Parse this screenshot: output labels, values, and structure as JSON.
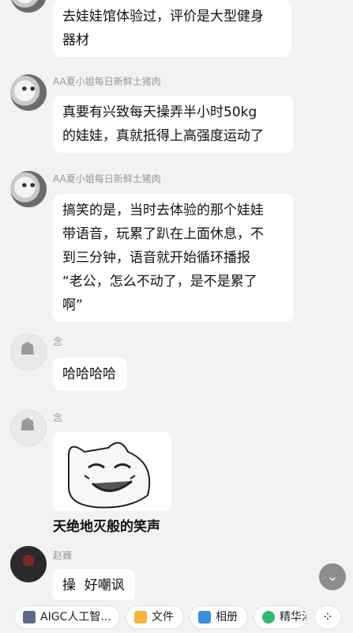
{
  "messages": [
    {
      "lines": [
        "去娃娃馆体验过，评价是大型健身",
        "器材"
      ]
    },
    {
      "sender": "AA夏小姐每日新鲜土猪肉",
      "lines": [
        "真要有兴致每天操弄半小时50kg",
        "的娃娃，真就抵得上高强度运动了"
      ]
    },
    {
      "sender": "AA夏小姐每日新鲜土猪肉",
      "lines": [
        "搞笑的是，当时去体验的那个娃娃",
        "带语音，玩累了趴在上面休息，不",
        "到三分钟，语音就开始循环播报",
        "“老公，怎么不动了，是不是累了",
        "啊”"
      ]
    },
    {
      "sender": "念",
      "lines": [
        "哈哈哈哈"
      ]
    },
    {
      "sender": "念",
      "sticker_caption": "天绝地灭般的笑声"
    },
    {
      "sender": "赵巍",
      "lines": [
        "操  好嘲讽"
      ]
    }
  ],
  "toolbar": {
    "items": [
      {
        "label": "AIGC人工智...",
        "icon": "app-icon"
      },
      {
        "label": "文件",
        "icon": "folder-icon"
      },
      {
        "label": "相册",
        "icon": "photo-icon"
      },
      {
        "label": "精华消",
        "icon": "star-icon"
      }
    ]
  },
  "colors": {
    "background": "#f2f2f2",
    "bubble": "#ffffff",
    "sender": "#999999"
  }
}
